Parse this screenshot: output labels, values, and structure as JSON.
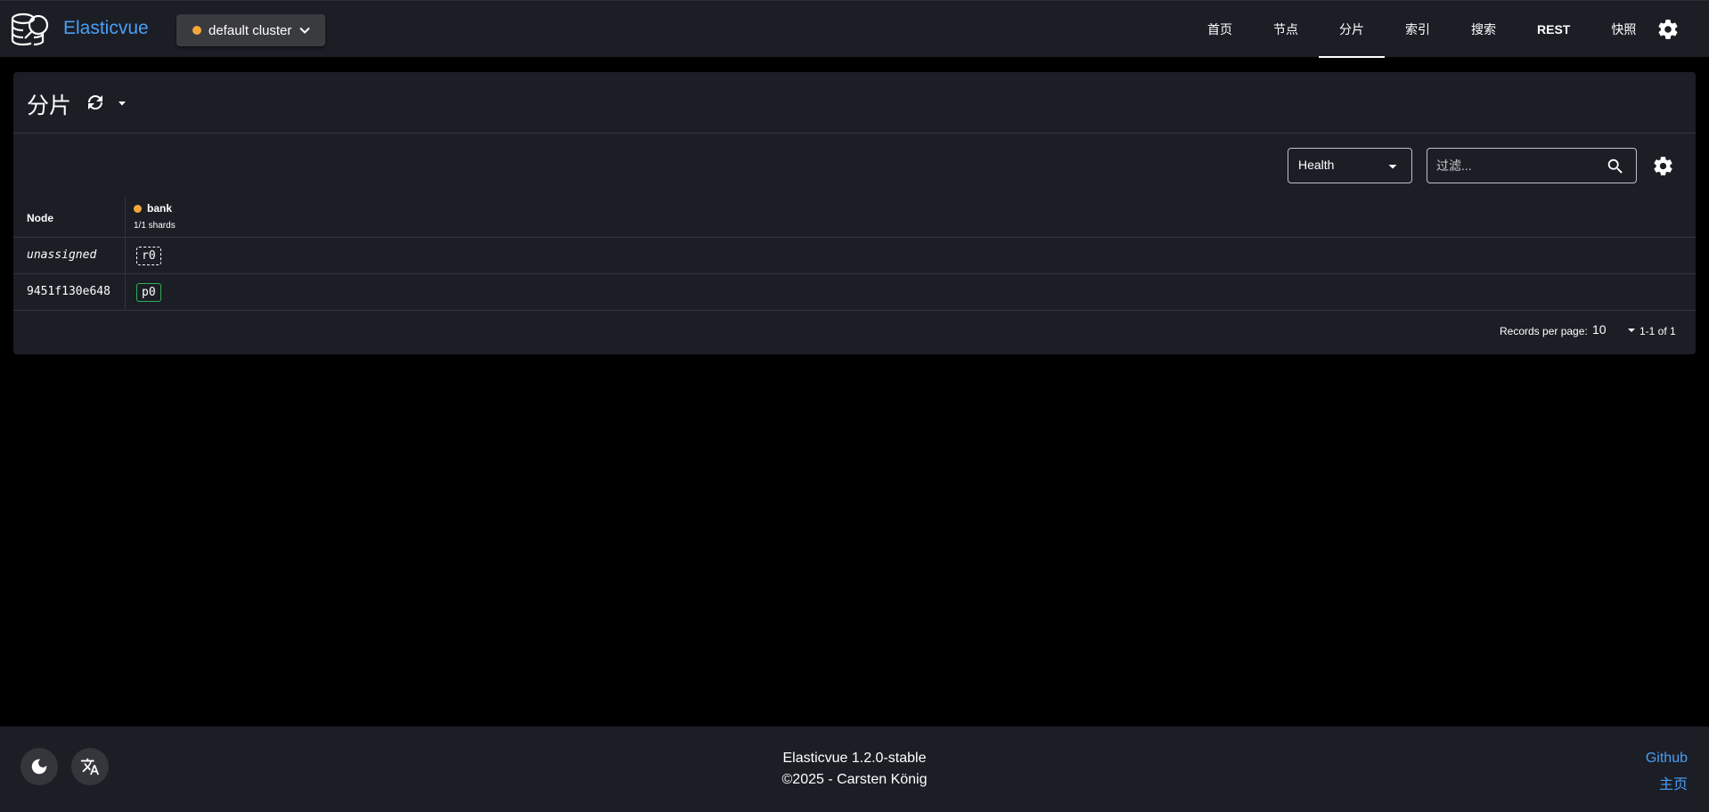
{
  "app": {
    "brand": "Elasticvue"
  },
  "cluster": {
    "label": "default cluster",
    "status_color": "#f5a738"
  },
  "nav": {
    "items": [
      {
        "label": "首页"
      },
      {
        "label": "节点"
      },
      {
        "label": "分片",
        "active": true
      },
      {
        "label": "索引"
      },
      {
        "label": "搜索"
      },
      {
        "label": "REST"
      },
      {
        "label": "快照"
      }
    ]
  },
  "page": {
    "title": "分片"
  },
  "toolbar": {
    "health_select": "Health",
    "filter_placeholder": "过滤..."
  },
  "table": {
    "node_header": "Node",
    "index": {
      "name": "bank",
      "status_color": "#f5a738",
      "shards_summary": "1/1 shards"
    },
    "rows": [
      {
        "node": "unassigned",
        "shard": "r0",
        "state": "unassigned"
      },
      {
        "node": "9451f130e648",
        "shard": "p0",
        "state": "primary"
      }
    ]
  },
  "pagination": {
    "label": "Records per page:",
    "per_page": "10",
    "range": "1-1 of 1"
  },
  "footer": {
    "version": "Elasticvue 1.2.0-stable",
    "copyright": "©2025 - Carsten König",
    "links": [
      "Github",
      "主页"
    ]
  },
  "colors": {
    "accent": "#4a9ff5",
    "warning": "#f5a738",
    "primary_shard": "#2fae55",
    "surface": "#1c1e26",
    "background": "#000000"
  }
}
